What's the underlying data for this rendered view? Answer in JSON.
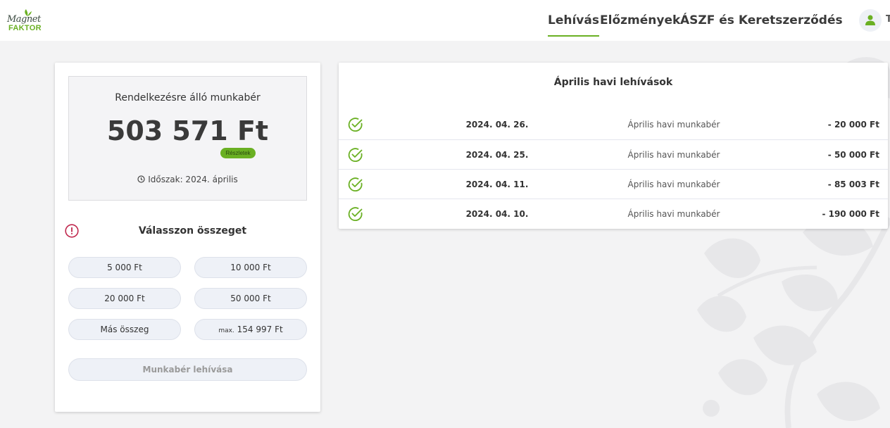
{
  "brand": {
    "logo_top": "Magnet",
    "logo_bottom": "FAKTOR",
    "accent": "#6ab023"
  },
  "nav": {
    "items": [
      {
        "label": "Lehívás",
        "active": true
      },
      {
        "label": "Előzmények",
        "active": false
      },
      {
        "label": "ÁSZF és Keretszerződés",
        "active": false
      }
    ],
    "user_initial": "T"
  },
  "balance": {
    "label": "Rendelkezésre álló munkabér",
    "amount": "503 571  Ft",
    "details_label": "Részletek",
    "period": "Időszak: 2024. április"
  },
  "choose": {
    "title": "Válasszon összeget",
    "options": [
      {
        "label": "5 000  Ft"
      },
      {
        "label": "10 000  Ft"
      },
      {
        "label": "20 000  Ft"
      },
      {
        "label": "50 000  Ft"
      },
      {
        "label": "Más összeg"
      },
      {
        "prefix": "max.",
        "label": "154 997  Ft"
      }
    ],
    "submit_label": "Munkabér lehívása"
  },
  "withdrawals": {
    "title": "Április havi lehívások",
    "rows": [
      {
        "date": "2024. 04. 26.",
        "description": "Április havi munkabér",
        "amount": "- 20 000  Ft"
      },
      {
        "date": "2024. 04. 25.",
        "description": "Április havi munkabér",
        "amount": "- 50 000  Ft"
      },
      {
        "date": "2024. 04. 11.",
        "description": "Április havi munkabér",
        "amount": "- 85 003  Ft"
      },
      {
        "date": "2024. 04. 10.",
        "description": "Április havi munkabér",
        "amount": "- 190 000  Ft"
      }
    ]
  },
  "icons": {
    "user": "user-icon",
    "clock": "clock-icon",
    "alert": "alert-circle-icon",
    "check": "check-circle-icon"
  }
}
